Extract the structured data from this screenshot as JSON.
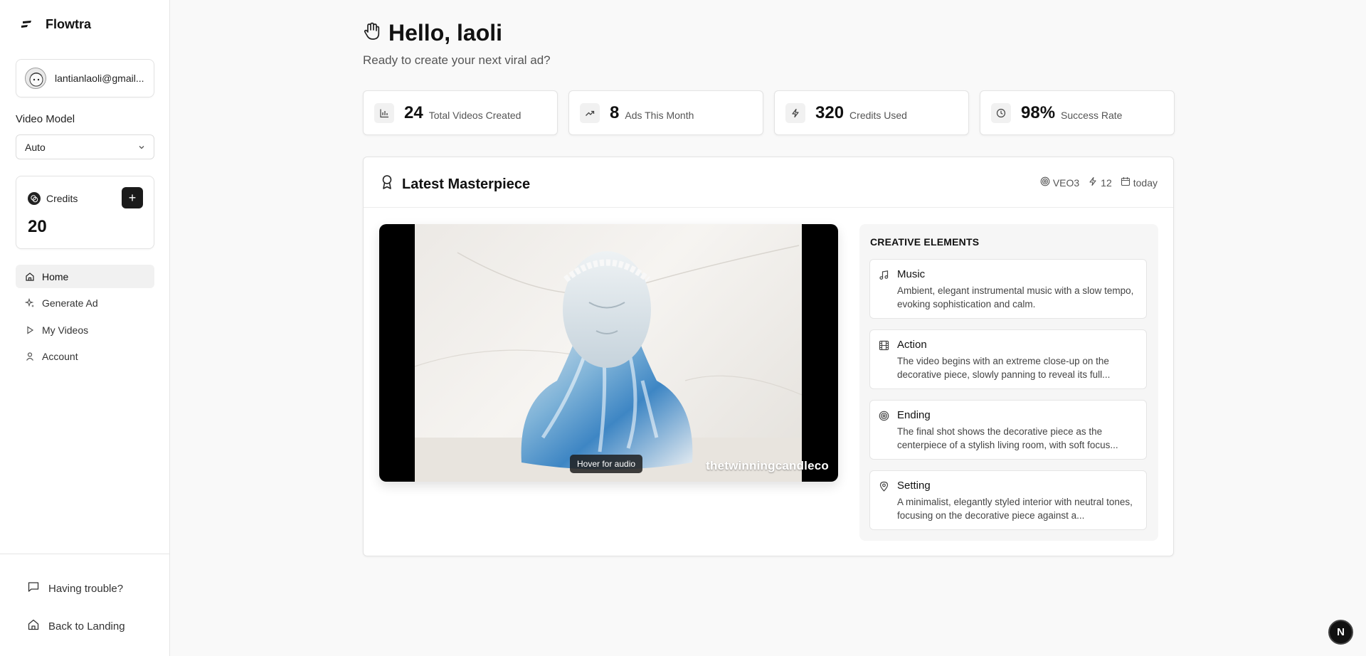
{
  "brand": {
    "name": "Flowtra"
  },
  "account": {
    "email": "lantianlaoli@gmail..."
  },
  "video_model": {
    "label": "Video Model",
    "selected": "Auto"
  },
  "credits": {
    "label": "Credits",
    "value": "20",
    "add_label": "+"
  },
  "nav": {
    "items": [
      {
        "label": "Home",
        "icon": "home-icon",
        "active": true
      },
      {
        "label": "Generate Ad",
        "icon": "sparkles-icon",
        "active": false
      },
      {
        "label": "My Videos",
        "icon": "play-icon",
        "active": false
      },
      {
        "label": "Account",
        "icon": "user-icon",
        "active": false
      }
    ]
  },
  "footer": {
    "trouble": "Having trouble?",
    "landing": "Back to Landing"
  },
  "header": {
    "greeting": "Hello, laoli",
    "subtitle": "Ready to create your next viral ad?"
  },
  "stats": [
    {
      "value": "24",
      "label": "Total Videos Created",
      "icon": "bar-chart-icon"
    },
    {
      "value": "8",
      "label": "Ads This Month",
      "icon": "trending-up-icon"
    },
    {
      "value": "320",
      "label": "Credits Used",
      "icon": "zap-icon"
    },
    {
      "value": "98%",
      "label": "Success Rate",
      "icon": "clock-icon"
    }
  ],
  "masterpiece": {
    "title": "Latest Masterpiece",
    "model": "VEO3",
    "credits": "12",
    "date": "today",
    "hover_hint": "Hover for audio",
    "watermark": "thetwinningcandleco"
  },
  "creative": {
    "title": "CREATIVE ELEMENTS",
    "items": [
      {
        "title": "Music",
        "icon": "music-icon",
        "desc": "Ambient, elegant instrumental music with a slow tempo, evoking sophistication and calm."
      },
      {
        "title": "Action",
        "icon": "film-icon",
        "desc": "The video begins with an extreme close-up on the decorative piece, slowly panning to reveal its full..."
      },
      {
        "title": "Ending",
        "icon": "target-icon",
        "desc": "The final shot shows the decorative piece as the centerpiece of a stylish living room, with soft focus..."
      },
      {
        "title": "Setting",
        "icon": "map-pin-icon",
        "desc": "A minimalist, elegantly styled interior with neutral tones, focusing on the decorative piece against a..."
      }
    ]
  },
  "fab": {
    "label": "N"
  }
}
